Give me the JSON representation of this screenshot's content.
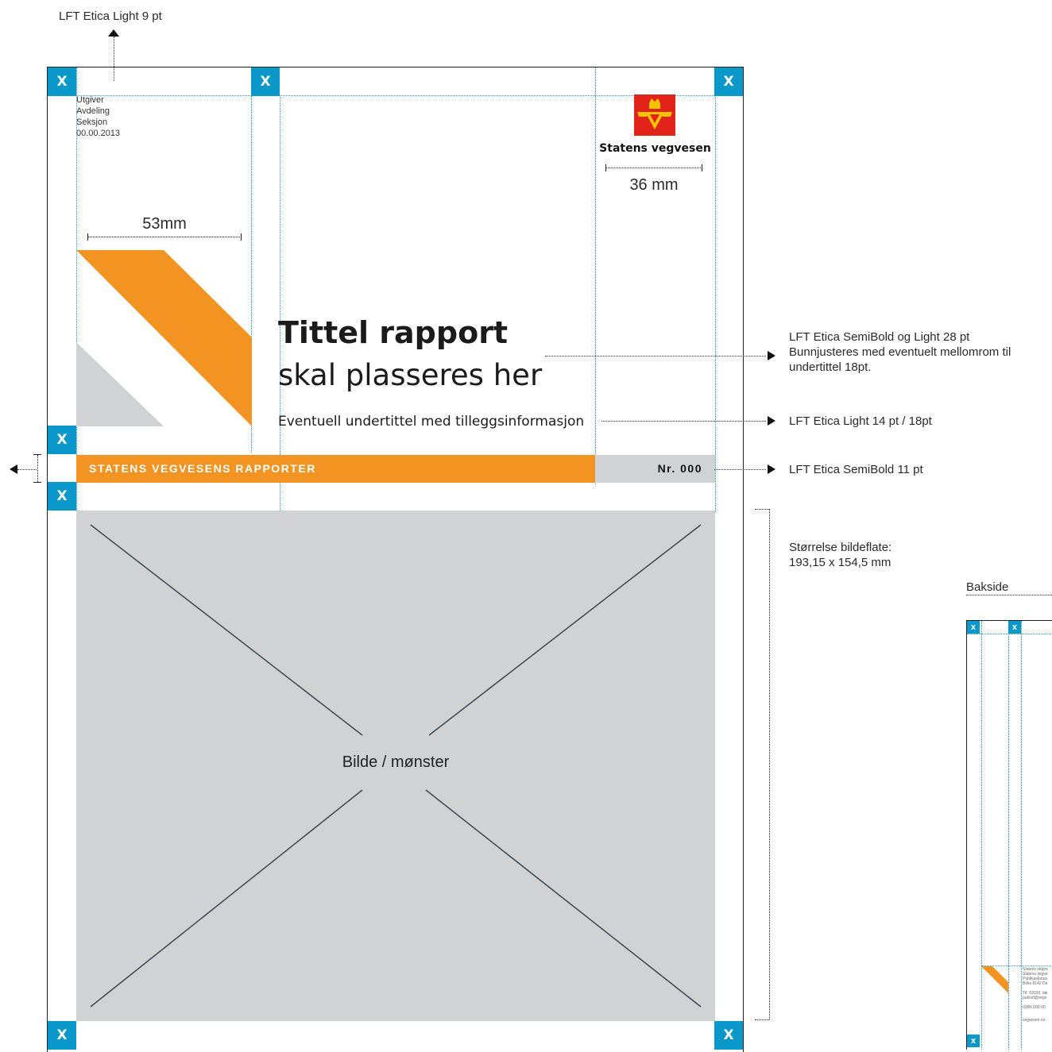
{
  "annotations": {
    "top_font": "LFT Etica Light 9 pt",
    "title_font_line1": "LFT Etica SemiBold og Light 28 pt",
    "title_font_line2": "Bunnjusteres med eventuelt mellomrom til",
    "title_font_line3": "undertittel 18pt.",
    "subtitle_font": "LFT Etica Light 14 pt / 18pt",
    "band_font": "LFT Etica SemiBold 11 pt",
    "image_size_line1": "Størrelse bildeflate:",
    "image_size_line2": "193,15 x 154,5 mm"
  },
  "publisher_lines": [
    "Utgiver",
    "Avdeling",
    "Seksjon",
    "00.00.2013"
  ],
  "logo": {
    "text": "Statens vegvesen",
    "measure": "36 mm"
  },
  "graphic_measure": "53mm",
  "title": {
    "bold": "Tittel rapport",
    "light": "skal plasseres her"
  },
  "subtitle": "Eventuell undertittel med tilleggsinformasjon",
  "band": {
    "label": "STATENS VEGVESENS RAPPORTER",
    "number": "Nr. 000"
  },
  "image_placeholder": "Bilde / mønster",
  "margin_marker": "X",
  "back": {
    "label": "Bakside",
    "marker": "X",
    "lines": [
      "Statens vegve",
      "Statens vegve",
      "Publikasjonsa",
      "Boks 8142 De",
      "Tlf. 02030, tak",
      "publvd@vegv",
      "ISBN 000-00",
      "vegvesen.no"
    ]
  },
  "colors": {
    "accent": "#0a97c9",
    "orange": "#f39322",
    "gray": "#d1d2d4",
    "logo_red": "#e2231a"
  }
}
